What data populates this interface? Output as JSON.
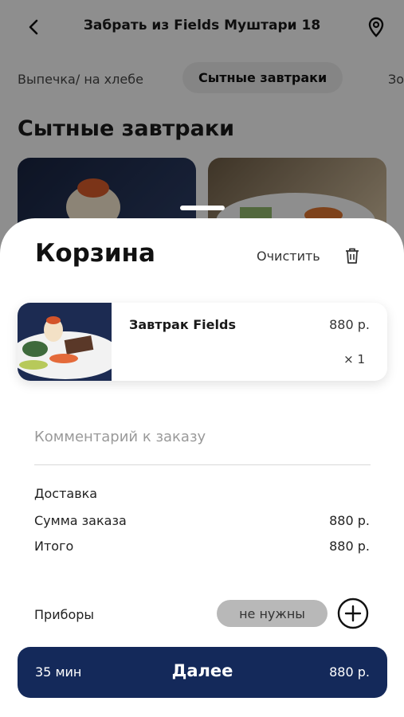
{
  "header": {
    "title": "Забрать из Fields Муштари 18"
  },
  "categories": {
    "items": [
      {
        "label": "Выпечка/ на хлебе"
      },
      {
        "label": "Сытные завтраки"
      },
      {
        "label": "Зо"
      }
    ]
  },
  "section": {
    "title": "Сытные завтраки"
  },
  "cart": {
    "title": "Корзина",
    "clear_label": "Очистить",
    "item": {
      "name": "Завтрак Fields",
      "price": "880 р.",
      "qty": "× 1"
    },
    "comment_placeholder": "Комментарий к заказу",
    "delivery_label": "Доставка",
    "sum_label": "Сумма заказа",
    "sum_value": "880 р.",
    "total_label": "Итого",
    "total_value": "880 р.",
    "cutlery_label": "Приборы",
    "cutlery_value": "не нужны"
  },
  "cta": {
    "time": "35 мин",
    "label": "Далее",
    "price": "880 р."
  },
  "colors": {
    "accent": "#14295a",
    "pill": "#b8b8b8"
  }
}
